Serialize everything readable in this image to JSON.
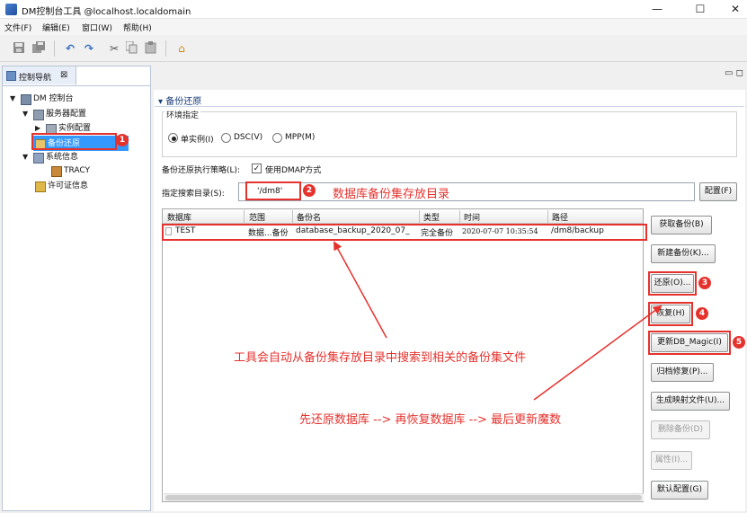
{
  "window": {
    "title": "DM控制台工具 @localhost.localdomain",
    "minimize": "—",
    "maximize": "☐",
    "close": "✕"
  },
  "menu": [
    "文件(F)",
    "编辑(E)",
    "窗口(W)",
    "帮助(H)"
  ],
  "toolbar": {
    "icons": [
      "save-icon",
      "save-all-icon",
      "undo-icon",
      "redo-icon",
      "cut-icon",
      "copy-icon",
      "paste-icon",
      "home-icon"
    ]
  },
  "nav_panel": {
    "tab_label": "控制导航",
    "tab_close": "⊠",
    "view_controls": "▭ ◻",
    "tree": [
      {
        "label": "DM 控制台",
        "arrow": "▼",
        "icon": "console-icon"
      },
      {
        "label": "服务器配置",
        "arrow": "▼",
        "icon": "server-config-icon"
      },
      {
        "label": "实例配置",
        "arrow": "▶",
        "icon": "instance-config-icon"
      },
      {
        "label": "备份还原",
        "arrow": "",
        "icon": "backup-restore-icon"
      },
      {
        "label": "系统信息",
        "arrow": "▼",
        "icon": "system-info-icon"
      },
      {
        "label": "TRACY",
        "arrow": "",
        "icon": "host-icon"
      },
      {
        "label": "许可证信息",
        "arrow": "",
        "icon": "license-icon"
      }
    ]
  },
  "backup_panel": {
    "section_title": "▾ 备份还原",
    "env_group_label": "环境指定",
    "radio_single": "单实例(I)",
    "radio_dsc": "DSC(V)",
    "radio_mpp": "MPP(M)",
    "strategy_label": "备份还原执行策略(L):",
    "dmap_label": "使用DMAP方式",
    "dmap_check": "✓",
    "dir_label": "指定搜索目录(S):",
    "dir_value": "'/dm8'",
    "config_button": "配置(F)",
    "table": {
      "headers": [
        "数据库",
        "范围",
        "备份名",
        "类型",
        "时间",
        "路径"
      ],
      "rows": [
        [
          "TEST",
          "数据...备份",
          "database_backup_2020_07_",
          "完全备份",
          "2020-07-07 10:35:54",
          "/dm8/backup"
        ]
      ]
    },
    "buttons": {
      "get_backup": "获取备份(B)",
      "new_backup": "新建备份(K)...",
      "restore": "还原(O)...",
      "recover": "恢复(H)",
      "update_magic": "更新DB_Magic(I)",
      "archive_repair": "归档修复(P)...",
      "gen_map": "生成映射文件(U)...",
      "delete_backup": "删除备份(D)",
      "properties": "属性(I)...",
      "default_config": "默认配置(G)"
    }
  },
  "annotations": {
    "badges": [
      "1",
      "2",
      "3",
      "4",
      "5"
    ],
    "dir_note": "数据库备份集存放目录",
    "search_note": "工具会自动从备份集存放目录中搜索到相关的备份集文件",
    "order_note": "先还原数据库 --> 再恢复数据库 --> 最后更新魔数",
    "color": "#e5322d"
  }
}
